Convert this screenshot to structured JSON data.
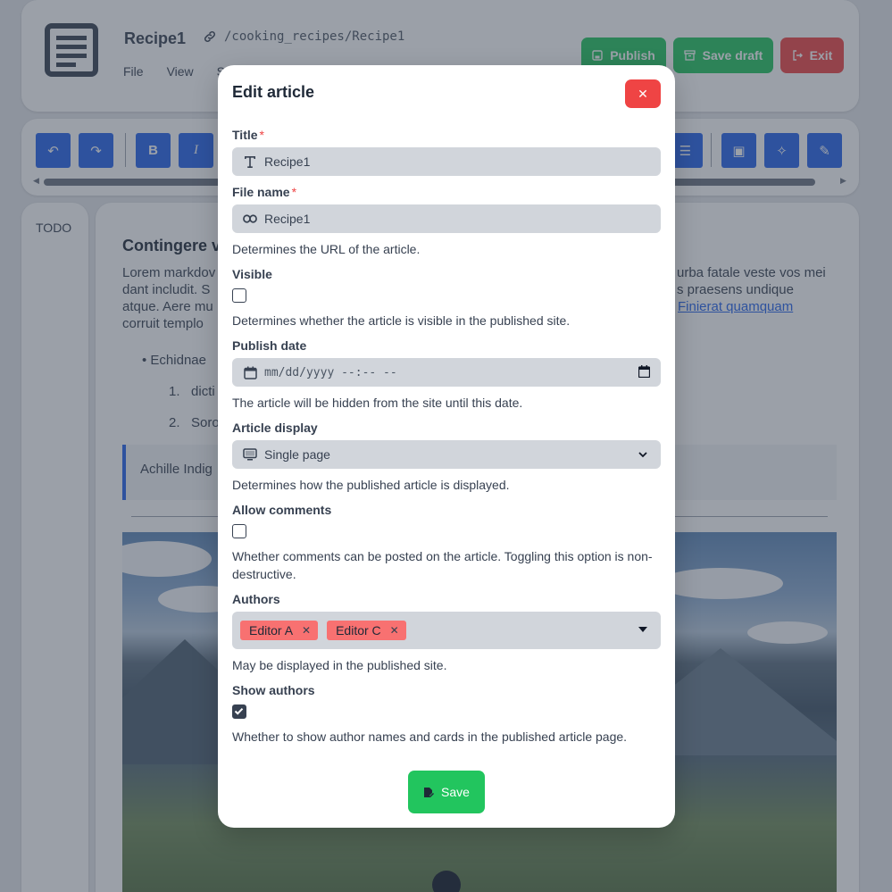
{
  "app": {
    "doc_title": "Recipe1",
    "doc_path": "/cooking_recipes/Recipe1",
    "menu": [
      "File",
      "View",
      "S"
    ],
    "publish_label": "Publish",
    "save_draft_label": "Save draft",
    "exit_label": "Exit"
  },
  "sidebar": {
    "todo_label": "TODO"
  },
  "editor": {
    "heading": "Contingere v",
    "para_line1_left": "Lorem markdov",
    "para_line1_right": "urba fatale veste vos mei",
    "para_line2_left": "dant includit. S",
    "para_line2_right": "s praesens undique",
    "para_line3_left": "atque. Aere mu",
    "para_link": "Finierat quamquam",
    "para_line4_left": "corruit templo",
    "bullet": "Echidnae",
    "ol_item1": "dicti",
    "ol_item2": "Soro",
    "quote": "Achille Indig"
  },
  "modal": {
    "title": "Edit article",
    "close_icon": "close-icon",
    "title_label": "Title",
    "title_value": "Recipe1",
    "filename_label": "File name",
    "filename_value": "Recipe1",
    "filename_help": "Determines the URL of the article.",
    "visible_label": "Visible",
    "visible_checked": false,
    "visible_help": "Determines whether the article is visible in the published site.",
    "publish_date_label": "Publish date",
    "publish_date_placeholder": "mm/dd/yyyy --:-- --",
    "publish_date_help": "The article will be hidden from the site until this date.",
    "display_label": "Article display",
    "display_value": "Single page",
    "display_help": "Determines how the published article is displayed.",
    "comments_label": "Allow comments",
    "comments_checked": false,
    "comments_help": "Whether comments can be posted on the article. Toggling this option is non-destructive.",
    "authors_label": "Authors",
    "authors": [
      "Editor A",
      "Editor C"
    ],
    "authors_help": "May be displayed in the published site.",
    "show_authors_label": "Show authors",
    "show_authors_checked": true,
    "show_authors_help": "Whether to show author names and cards in the published article page.",
    "save_label": "Save"
  },
  "colors": {
    "primary": "#2563eb",
    "success": "#22c55e",
    "danger": "#ef4444",
    "tag": "#f87171"
  }
}
